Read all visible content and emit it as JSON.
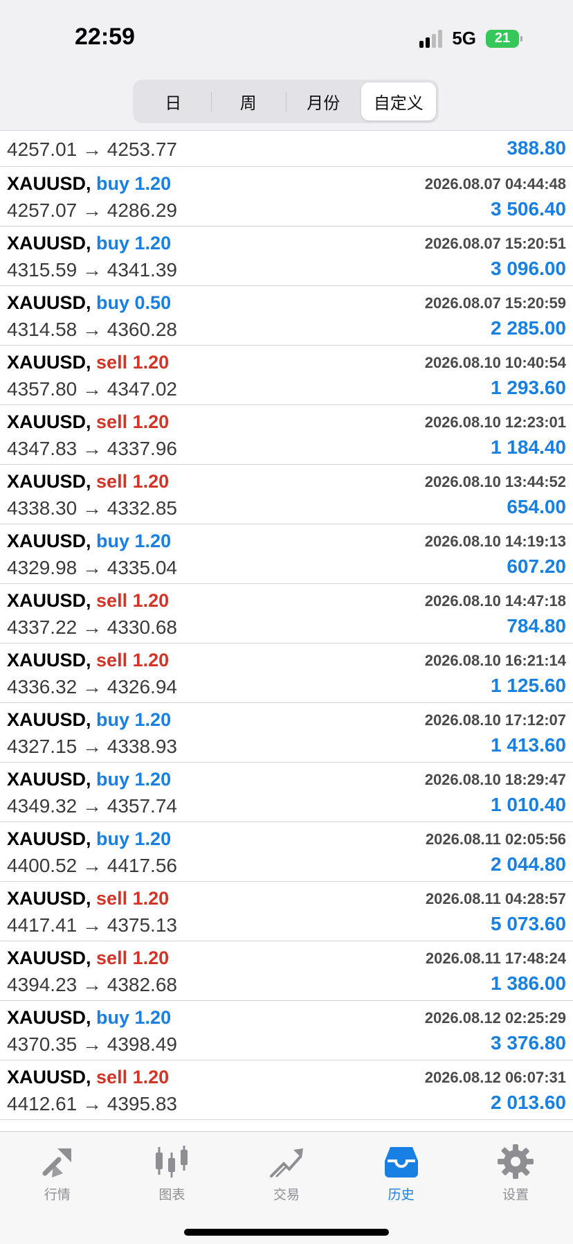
{
  "status": {
    "time": "22:59",
    "network": "5G",
    "battery": "21"
  },
  "period_tabs": [
    {
      "label": "日",
      "active": false
    },
    {
      "label": "周",
      "active": false
    },
    {
      "label": "月份",
      "active": false
    },
    {
      "label": "自定义",
      "active": true
    }
  ],
  "partial_row": {
    "prices": "4257.01 → 4253.77",
    "profit": "388.80"
  },
  "trades": [
    {
      "symbol": "XAUUSD,",
      "side": "buy 1.20",
      "type": "buy",
      "time": "2026.08.07 04:44:48",
      "prices": "4257.07 → 4286.29",
      "profit": "3 506.40"
    },
    {
      "symbol": "XAUUSD,",
      "side": "buy 1.20",
      "type": "buy",
      "time": "2026.08.07 15:20:51",
      "prices": "4315.59 → 4341.39",
      "profit": "3 096.00"
    },
    {
      "symbol": "XAUUSD,",
      "side": "buy 0.50",
      "type": "buy",
      "time": "2026.08.07 15:20:59",
      "prices": "4314.58 → 4360.28",
      "profit": "2 285.00"
    },
    {
      "symbol": "XAUUSD,",
      "side": "sell 1.20",
      "type": "sell",
      "time": "2026.08.10 10:40:54",
      "prices": "4357.80 → 4347.02",
      "profit": "1 293.60"
    },
    {
      "symbol": "XAUUSD,",
      "side": "sell 1.20",
      "type": "sell",
      "time": "2026.08.10 12:23:01",
      "prices": "4347.83 → 4337.96",
      "profit": "1 184.40"
    },
    {
      "symbol": "XAUUSD,",
      "side": "sell 1.20",
      "type": "sell",
      "time": "2026.08.10 13:44:52",
      "prices": "4338.30 → 4332.85",
      "profit": "654.00"
    },
    {
      "symbol": "XAUUSD,",
      "side": "buy 1.20",
      "type": "buy",
      "time": "2026.08.10 14:19:13",
      "prices": "4329.98 → 4335.04",
      "profit": "607.20"
    },
    {
      "symbol": "XAUUSD,",
      "side": "sell 1.20",
      "type": "sell",
      "time": "2026.08.10 14:47:18",
      "prices": "4337.22 → 4330.68",
      "profit": "784.80"
    },
    {
      "symbol": "XAUUSD,",
      "side": "sell 1.20",
      "type": "sell",
      "time": "2026.08.10 16:21:14",
      "prices": "4336.32 → 4326.94",
      "profit": "1 125.60"
    },
    {
      "symbol": "XAUUSD,",
      "side": "buy 1.20",
      "type": "buy",
      "time": "2026.08.10 17:12:07",
      "prices": "4327.15 → 4338.93",
      "profit": "1 413.60"
    },
    {
      "symbol": "XAUUSD,",
      "side": "buy 1.20",
      "type": "buy",
      "time": "2026.08.10 18:29:47",
      "prices": "4349.32 → 4357.74",
      "profit": "1 010.40"
    },
    {
      "symbol": "XAUUSD,",
      "side": "buy 1.20",
      "type": "buy",
      "time": "2026.08.11 02:05:56",
      "prices": "4400.52 → 4417.56",
      "profit": "2 044.80"
    },
    {
      "symbol": "XAUUSD,",
      "side": "sell 1.20",
      "type": "sell",
      "time": "2026.08.11 04:28:57",
      "prices": "4417.41 → 4375.13",
      "profit": "5 073.60"
    },
    {
      "symbol": "XAUUSD,",
      "side": "sell 1.20",
      "type": "sell",
      "time": "2026.08.11 17:48:24",
      "prices": "4394.23 → 4382.68",
      "profit": "1 386.00"
    },
    {
      "symbol": "XAUUSD,",
      "side": "buy 1.20",
      "type": "buy",
      "time": "2026.08.12 02:25:29",
      "prices": "4370.35 → 4398.49",
      "profit": "3 376.80"
    },
    {
      "symbol": "XAUUSD,",
      "side": "sell 1.20",
      "type": "sell",
      "time": "2026.08.12 06:07:31",
      "prices": "4412.61 → 4395.83",
      "profit": "2 013.60"
    }
  ],
  "bottom_tabs": [
    {
      "label": "行情",
      "icon": "quotes-icon",
      "active": false
    },
    {
      "label": "图表",
      "icon": "chart-icon",
      "active": false
    },
    {
      "label": "交易",
      "icon": "trade-icon",
      "active": false
    },
    {
      "label": "历史",
      "icon": "history-icon",
      "active": true
    },
    {
      "label": "设置",
      "icon": "settings-icon",
      "active": false
    }
  ],
  "colors": {
    "buy": "#1780e2",
    "sell": "#d43425",
    "profit": "#1780e2",
    "active_tab": "#1780e2",
    "inactive_tab": "#8e8e93"
  }
}
